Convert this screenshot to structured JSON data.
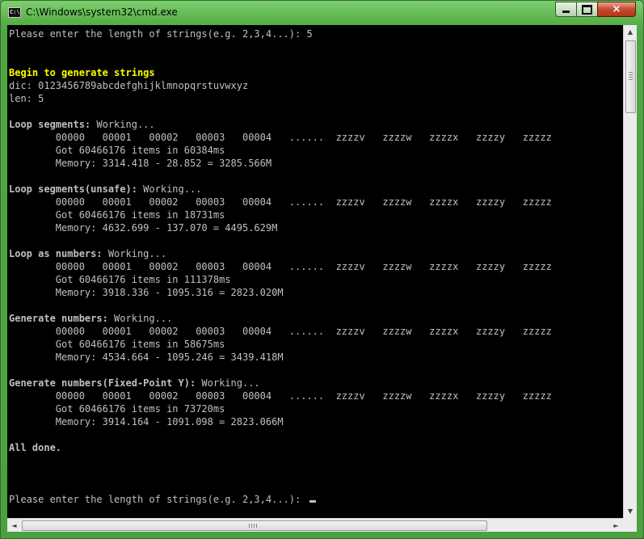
{
  "window": {
    "title": "C:\\Windows\\system32\\cmd.exe",
    "icon_text": "C:\\",
    "controls": {
      "minimize": "minimize-icon",
      "maximize": "maximize-icon",
      "close": "×"
    }
  },
  "colors": {
    "console_bg": "#000000",
    "text": "#c0c0c0",
    "highlight": "#ffff00",
    "frame": "#58b048"
  },
  "console": {
    "lines": [
      {
        "text": "Please enter the length of strings(e.g. 2,3,4...): 5"
      },
      {
        "text": ""
      },
      {
        "text": ""
      },
      {
        "text": "Begin to generate strings",
        "style": "yellow"
      },
      {
        "text": "dic: 0123456789abcdefghijklmnopqrstuvwxyz"
      },
      {
        "text": "len: 5"
      },
      {
        "text": ""
      },
      {
        "label": "Loop segments:",
        "text": " Working..."
      },
      {
        "text": "        00000   00001   00002   00003   00004   ......  zzzzv   zzzzw   zzzzx   zzzzy   zzzzz"
      },
      {
        "text": "        Got 60466176 items in 60384ms"
      },
      {
        "text": "        Memory: 3314.418 - 28.852 = 3285.566M"
      },
      {
        "text": ""
      },
      {
        "label": "Loop segments(unsafe):",
        "text": " Working..."
      },
      {
        "text": "        00000   00001   00002   00003   00004   ......  zzzzv   zzzzw   zzzzx   zzzzy   zzzzz"
      },
      {
        "text": "        Got 60466176 items in 18731ms"
      },
      {
        "text": "        Memory: 4632.699 - 137.070 = 4495.629M"
      },
      {
        "text": ""
      },
      {
        "label": "Loop as numbers:",
        "text": " Working..."
      },
      {
        "text": "        00000   00001   00002   00003   00004   ......  zzzzv   zzzzw   zzzzx   zzzzy   zzzzz"
      },
      {
        "text": "        Got 60466176 items in 111378ms"
      },
      {
        "text": "        Memory: 3918.336 - 1095.316 = 2823.020M"
      },
      {
        "text": ""
      },
      {
        "label": "Generate numbers:",
        "text": " Working..."
      },
      {
        "text": "        00000   00001   00002   00003   00004   ......  zzzzv   zzzzw   zzzzx   zzzzy   zzzzz"
      },
      {
        "text": "        Got 60466176 items in 58675ms"
      },
      {
        "text": "        Memory: 4534.664 - 1095.246 = 3439.418M"
      },
      {
        "text": ""
      },
      {
        "label": "Generate numbers(Fixed-Point Y):",
        "text": " Working..."
      },
      {
        "text": "        00000   00001   00002   00003   00004   ......  zzzzv   zzzzw   zzzzx   zzzzy   zzzzz"
      },
      {
        "text": "        Got 60466176 items in 73720ms"
      },
      {
        "text": "        Memory: 3914.164 - 1091.098 = 2823.066M"
      },
      {
        "text": ""
      },
      {
        "text": "All done.",
        "style": "bold"
      },
      {
        "text": ""
      },
      {
        "text": ""
      },
      {
        "text": ""
      },
      {
        "text": "Please enter the length of strings(e.g. 2,3,4...): ",
        "cursor": true
      }
    ]
  },
  "scrollbars": {
    "vertical": {
      "up": "▲",
      "down": "▼",
      "position": 0.0
    },
    "horizontal": {
      "left": "◄",
      "right": "►",
      "position": 0.0
    }
  }
}
